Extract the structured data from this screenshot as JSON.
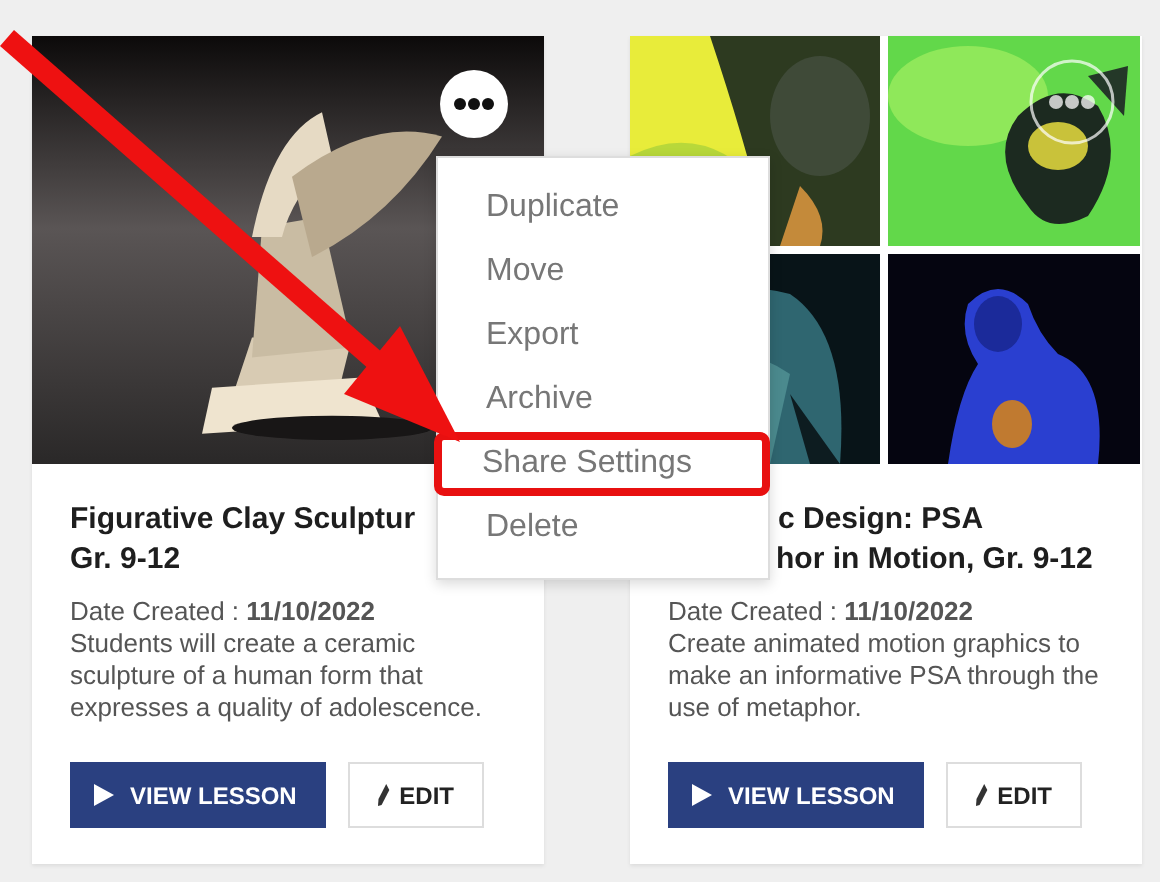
{
  "cards": [
    {
      "kind": "single",
      "title_lines": [
        "Figurative Clay Sculptur",
        "Gr. 9-12"
      ],
      "date_line": "Date Created : **11/10/2022**",
      "description": "Students will create a ceramic sculpture of a human form that expresses a quality of adolescence.",
      "buttons": [
        {
          "kind": "primary",
          "label": "VIEW LESSON"
        },
        {
          "kind": "edit",
          "label": "EDIT"
        }
      ]
    },
    {
      "kind": "quad",
      "title_lines": [
        "c Design: PSA",
        "hor in Motion, Gr. 9-12"
      ],
      "date_line": "Date Created : **11/10/2022**",
      "description": "Create animated motion graphics to make an informative PSA through the use of metaphor.",
      "buttons": [
        {
          "kind": "primary",
          "label": "VIEW LESSON"
        },
        {
          "kind": "edit",
          "label": "EDIT"
        }
      ]
    }
  ],
  "menu": {
    "items": [
      {
        "label": "Duplicate",
        "highlighted": false
      },
      {
        "label": "Move",
        "highlighted": false
      },
      {
        "label": "Export",
        "highlighted": false
      },
      {
        "label": "Archive",
        "highlighted": false
      },
      {
        "label": "Share Settings",
        "highlighted": true
      },
      {
        "label": "Delete",
        "highlighted": false
      }
    ]
  }
}
